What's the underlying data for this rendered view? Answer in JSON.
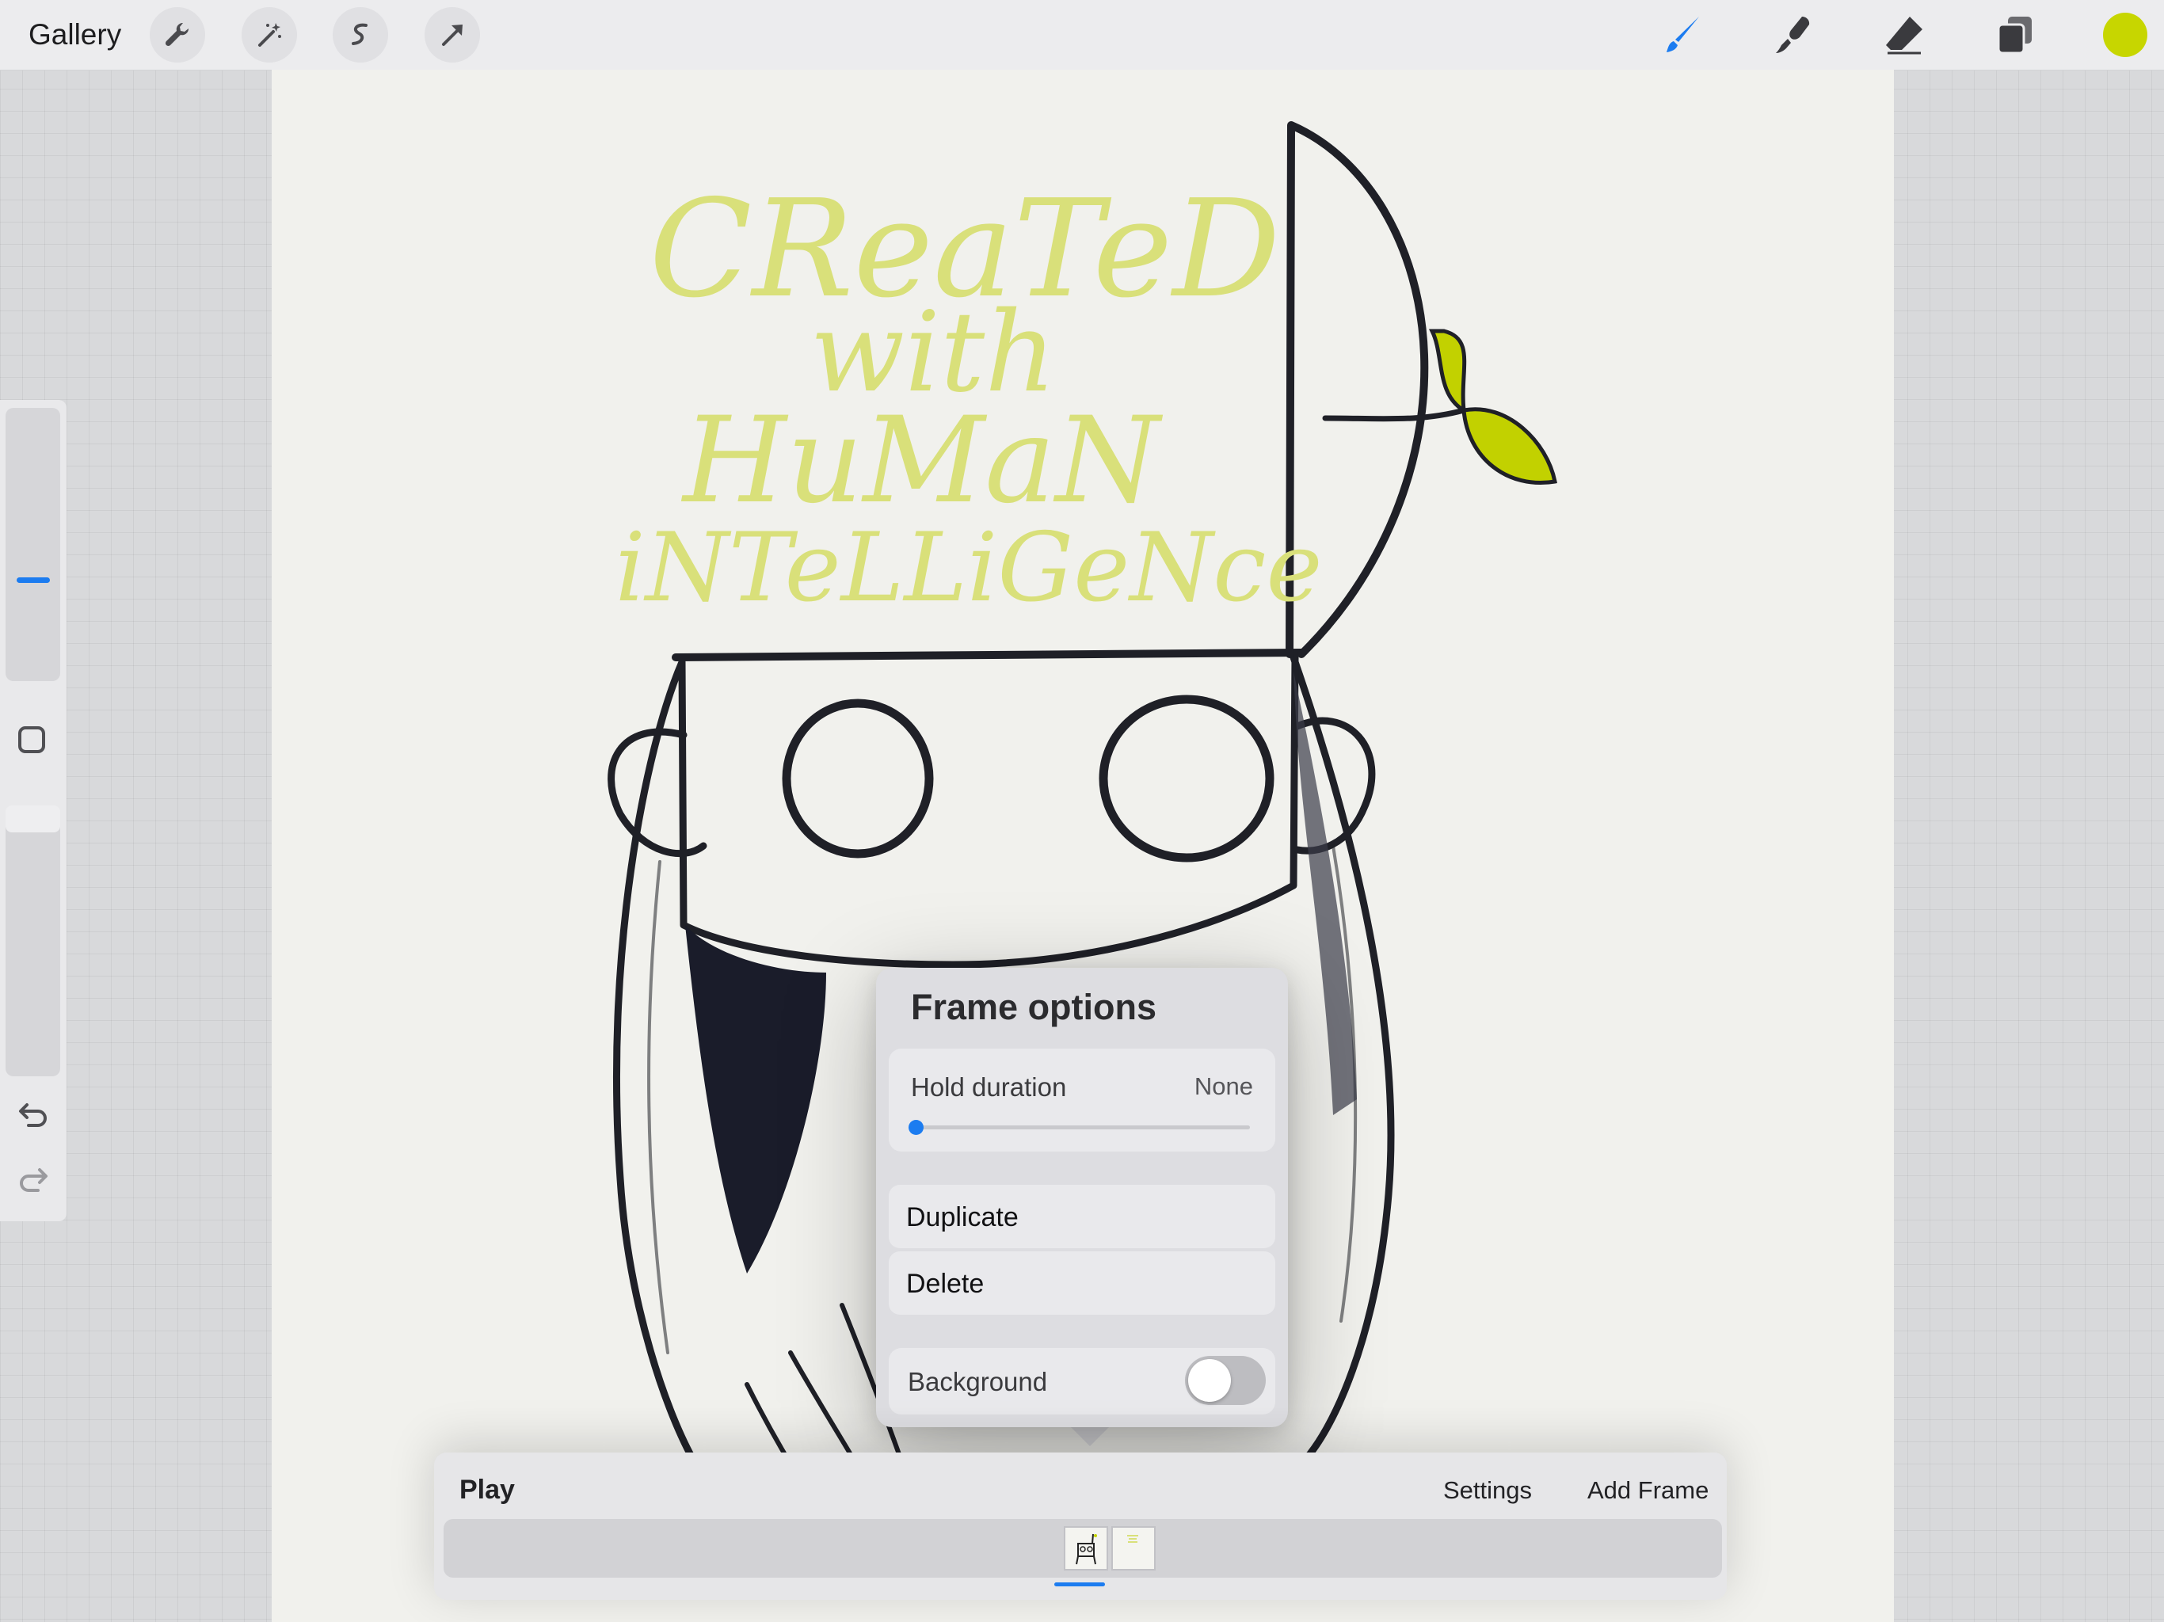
{
  "toolbar": {
    "gallery_label": "Gallery",
    "left_tools": [
      "wrench-icon",
      "magic-wand-icon",
      "selection-icon",
      "transform-arrow-icon"
    ],
    "right_tools": [
      "brush-icon",
      "smudge-icon",
      "eraser-icon",
      "layers-icon"
    ],
    "active_tool": "brush-icon",
    "current_color": "#c7d600"
  },
  "artwork": {
    "lettering": [
      "CReaTeD",
      "with",
      "HuMaN",
      "iNTeLLiGeNce"
    ],
    "lettering_color": "#d9e07a",
    "leaf_color": "#c2d100"
  },
  "sidebar": {
    "size_level": 0.38,
    "opacity_level": 1.0,
    "icons": [
      "modify-square-icon",
      "undo-icon",
      "redo-icon"
    ]
  },
  "frame_options": {
    "title": "Frame options",
    "hold_duration_label": "Hold duration",
    "hold_duration_value": "None",
    "hold_duration_level": 0,
    "duplicate_label": "Duplicate",
    "delete_label": "Delete",
    "background_label": "Background",
    "background_enabled": false
  },
  "timeline": {
    "play_label": "Play",
    "settings_label": "Settings",
    "add_frame_label": "Add Frame",
    "frame_count": 2,
    "selected_frame": 1
  },
  "colors": {
    "accent": "#1c7cf0",
    "canvas": "#f1f1ed"
  }
}
